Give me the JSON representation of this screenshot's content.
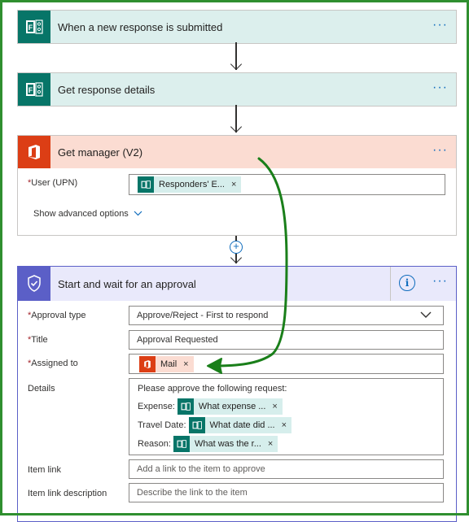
{
  "steps": [
    {
      "title": "When a new response is submitted",
      "more": "···"
    },
    {
      "title": "Get response details",
      "more": "···"
    },
    {
      "title": "Get manager (V2)",
      "more": "···",
      "fields": {
        "user_label": "User (UPN)",
        "user_token": "Responders' E...",
        "advanced_label": "Show advanced options"
      }
    }
  ],
  "insert_step": "+",
  "approval": {
    "title": "Start and wait for an approval",
    "info": "i",
    "more": "···",
    "approval_type_label": "Approval type",
    "approval_type_value": "Approve/Reject - First to respond",
    "title_label": "Title",
    "title_value": "Approval Requested",
    "assigned_label": "Assigned to",
    "assigned_token": "Mail",
    "details_label": "Details",
    "details_intro": "Please approve the following request:",
    "details_rows": [
      {
        "prefix": "Expense:",
        "token": "What expense ..."
      },
      {
        "prefix": "Travel Date:",
        "token": "What date did ..."
      },
      {
        "prefix": "Reason:",
        "token": "What was the r..."
      }
    ],
    "item_link_label": "Item link",
    "item_link_placeholder": "Add a link to the item to approve",
    "item_link_desc_label": "Item link description",
    "item_link_desc_placeholder": "Describe the link to the item"
  },
  "required_mark": "*",
  "remove_mark": "×",
  "colors": {
    "forms_teal": "#077568",
    "office_orange": "#dc3e15",
    "approvals_purple": "#5b5fc7",
    "annotation_green": "#1a7f1a"
  }
}
